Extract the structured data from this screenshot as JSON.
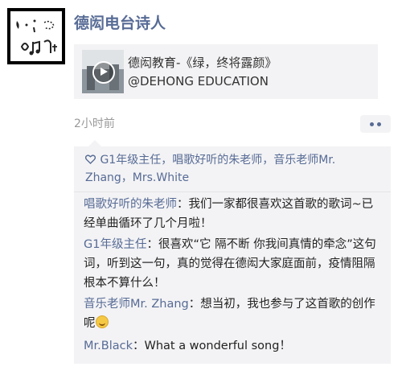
{
  "post": {
    "author": "德闳电台诗人",
    "link": {
      "title": "德闳教育-《绿，终将露颜》",
      "subtitle": "@DEHONG EDUCATION"
    },
    "time": "2小时前",
    "more_icon": "more-dots-icon"
  },
  "likes": {
    "icon": "heart-icon",
    "names": "G1年级主任，唱歌好听的朱老师，音乐老师Mr. Zhang，Mrs.White"
  },
  "comments": [
    {
      "author": "唱歌好听的朱老师",
      "sep": "：",
      "text": "我们一家都很喜欢这首歌的歌词~已经单曲循环了几个月啦！"
    },
    {
      "author": "G1年级主任",
      "sep": "：",
      "text": "很喜欢“它 隔不断 你我间真情的牵念”这句词，听到这一句，真的觉得在德闳大家庭面前，疫情阻隔根本不算什么！"
    },
    {
      "author": "音乐老师Mr. Zhang",
      "sep": "：",
      "text": "想当初，我也参与了这首歌的创作呢"
    },
    {
      "author": "Mr.Black",
      "sep": "：",
      "text": "What a wonderful song！"
    }
  ]
}
